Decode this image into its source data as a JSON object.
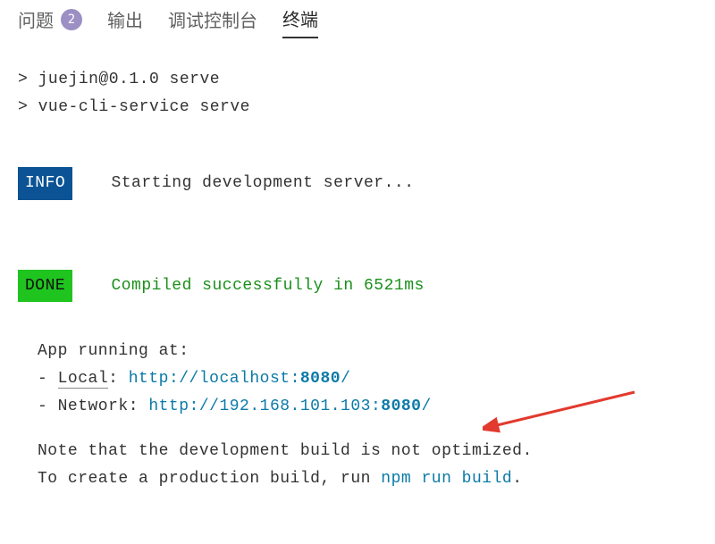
{
  "tabs": {
    "problems": {
      "label": "问题",
      "count": "2"
    },
    "output": {
      "label": "输出"
    },
    "debug": {
      "label": "调试控制台"
    },
    "terminal": {
      "label": "终端"
    }
  },
  "terminal": {
    "line1_prompt": ">",
    "line1_cmd": "juejin@0.1.0 serve",
    "line2_prompt": ">",
    "line2_cmd": "vue-cli-service serve",
    "info_badge": "INFO",
    "info_text": "Starting development server...",
    "done_badge": "DONE",
    "done_text": "Compiled successfully in 6521ms",
    "app_running_heading": "App running at:",
    "local_prefix": "- ",
    "local_label": "Local",
    "local_colon": ":   ",
    "local_url_pre": "http://localhost:",
    "local_port": "8080",
    "local_url_post": "/",
    "network_prefix": "- Network: ",
    "network_url_pre": "http://192.168.101.103:",
    "network_port": "8080",
    "network_url_post": "/",
    "note_line1": "Note that the development build is not optimized.",
    "note_line2_pre": "To create a production build, run ",
    "note_line2_cmd": "npm run build",
    "note_line2_post": "."
  }
}
